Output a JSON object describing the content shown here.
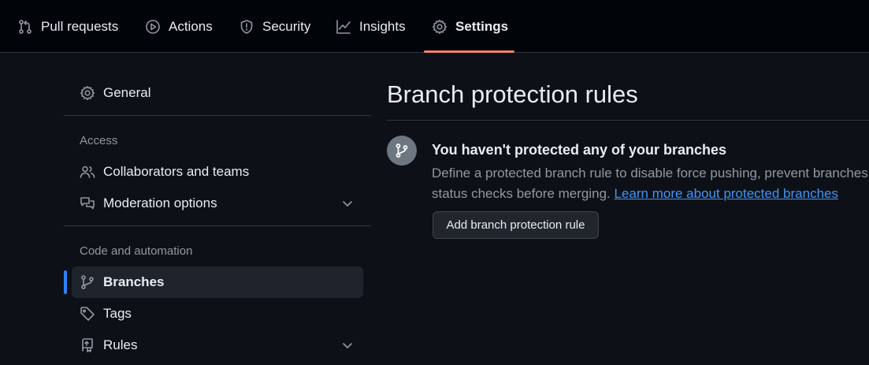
{
  "nav": {
    "tabs": [
      {
        "label": "Pull requests",
        "icon": "pull-request-icon"
      },
      {
        "label": "Actions",
        "icon": "play-circle-icon"
      },
      {
        "label": "Security",
        "icon": "shield-icon"
      },
      {
        "label": "Insights",
        "icon": "graph-icon"
      },
      {
        "label": "Settings",
        "icon": "gear-icon",
        "selected": true
      }
    ],
    "accent_color": "#f78166"
  },
  "sidebar": {
    "general": {
      "label": "General",
      "icon": "gear-icon"
    },
    "sections": [
      {
        "heading": "Access",
        "items": [
          {
            "label": "Collaborators and teams",
            "icon": "people-icon"
          },
          {
            "label": "Moderation options",
            "icon": "comment-discussion-icon",
            "expandable": true
          }
        ]
      },
      {
        "heading": "Code and automation",
        "items": [
          {
            "label": "Branches",
            "icon": "git-branch-icon",
            "active": true
          },
          {
            "label": "Tags",
            "icon": "tag-icon"
          },
          {
            "label": "Rules",
            "icon": "repo-push-icon",
            "expandable": true
          }
        ]
      }
    ],
    "active_color": "#2f81f7"
  },
  "main": {
    "title": "Branch protection rules",
    "blankslate": {
      "icon": "git-branch-icon",
      "heading": "You haven't protected any of your branches",
      "description_line1": "Define a protected branch rule to disable force pushing, prevent branches from being deleted, and optionally require",
      "description_line2": "status checks before merging.",
      "link_text": "Learn more about protected branches",
      "link_color": "#4493f8"
    },
    "add_button_label": "Add branch protection rule"
  }
}
